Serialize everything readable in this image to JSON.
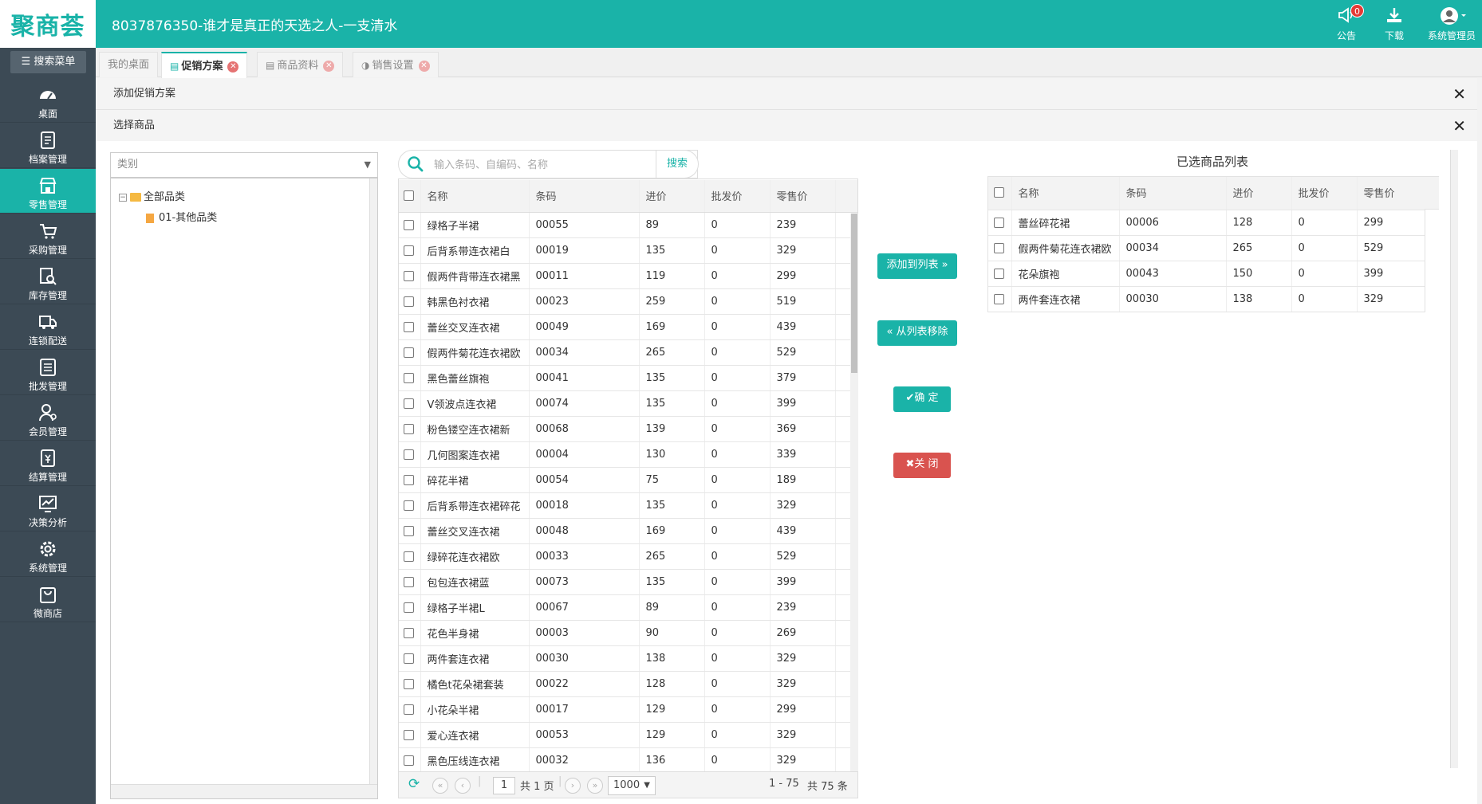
{
  "header": {
    "logo": "聚商荟",
    "title": "8037876350-谁才是真正的天选之人-一支清水",
    "notice": {
      "label": "公告",
      "badge": "0"
    },
    "download": {
      "label": "下载"
    },
    "user": {
      "label": "系统管理员"
    }
  },
  "sidebar": {
    "search_label": "搜索菜单",
    "items": [
      {
        "label": "桌面",
        "icon": "dashboard-icon"
      },
      {
        "label": "档案管理",
        "icon": "archive-icon"
      },
      {
        "label": "零售管理",
        "icon": "store-icon",
        "active": true
      },
      {
        "label": "采购管理",
        "icon": "cart-icon"
      },
      {
        "label": "库存管理",
        "icon": "inventory-icon"
      },
      {
        "label": "连锁配送",
        "icon": "delivery-icon"
      },
      {
        "label": "批发管理",
        "icon": "wholesale-icon"
      },
      {
        "label": "会员管理",
        "icon": "member-icon"
      },
      {
        "label": "结算管理",
        "icon": "settlement-icon"
      },
      {
        "label": "决策分析",
        "icon": "analysis-icon"
      },
      {
        "label": "系统管理",
        "icon": "gear-icon"
      },
      {
        "label": "微商店",
        "icon": "shop-bag-icon"
      }
    ]
  },
  "tabs": [
    {
      "label": "我的桌面"
    },
    {
      "label": "促销方案",
      "active": true
    },
    {
      "label": "商品资料"
    },
    {
      "label": "销售设置"
    }
  ],
  "panels": {
    "add_promo": "添加促销方案",
    "select_goods": "选择商品"
  },
  "category": {
    "placeholder": "类别",
    "root": "全部品类",
    "child": "01-其他品类"
  },
  "search": {
    "placeholder": "输入条码、自编码、名称",
    "button": "搜索"
  },
  "product_table": {
    "headers": [
      "名称",
      "条码",
      "进价",
      "批发价",
      "零售价"
    ],
    "rows": [
      [
        "绿格子半裙",
        "00055",
        "89",
        "0",
        "239"
      ],
      [
        "后背系带连衣裙白",
        "00019",
        "135",
        "0",
        "329"
      ],
      [
        "假两件背带连衣裙黑",
        "00011",
        "119",
        "0",
        "299"
      ],
      [
        "韩黑色衬衣裙",
        "00023",
        "259",
        "0",
        "519"
      ],
      [
        "蕾丝交叉连衣裙",
        "00049",
        "169",
        "0",
        "439"
      ],
      [
        "假两件菊花连衣裙欧",
        "00034",
        "265",
        "0",
        "529"
      ],
      [
        "黑色蕾丝旗袍",
        "00041",
        "135",
        "0",
        "379"
      ],
      [
        "V领波点连衣裙",
        "00074",
        "135",
        "0",
        "399"
      ],
      [
        "粉色镂空连衣裙新",
        "00068",
        "139",
        "0",
        "369"
      ],
      [
        "几何图案连衣裙",
        "00004",
        "130",
        "0",
        "339"
      ],
      [
        "碎花半裙",
        "00054",
        "75",
        "0",
        "189"
      ],
      [
        "后背系带连衣裙碎花",
        "00018",
        "135",
        "0",
        "329"
      ],
      [
        "蕾丝交叉连衣裙",
        "00048",
        "169",
        "0",
        "439"
      ],
      [
        "绿碎花连衣裙欧",
        "00033",
        "265",
        "0",
        "529"
      ],
      [
        "包包连衣裙蓝",
        "00073",
        "135",
        "0",
        "399"
      ],
      [
        "绿格子半裙L",
        "00067",
        "89",
        "0",
        "239"
      ],
      [
        "花色半身裙",
        "00003",
        "90",
        "0",
        "269"
      ],
      [
        "两件套连衣裙",
        "00030",
        "138",
        "0",
        "329"
      ],
      [
        "橘色t花朵裙套装",
        "00022",
        "128",
        "0",
        "329"
      ],
      [
        "小花朵半裙",
        "00017",
        "129",
        "0",
        "299"
      ],
      [
        "爱心连衣裙",
        "00053",
        "129",
        "0",
        "329"
      ],
      [
        "黑色压线连衣裙",
        "00032",
        "136",
        "0",
        "329"
      ]
    ]
  },
  "pager": {
    "page": "1",
    "total_pages": "共 1 页",
    "page_size": "1000",
    "range": "1 - 75",
    "total": "共 75 条"
  },
  "actions": {
    "add_to_list": "添加到列表",
    "remove_from_list": "从列表移除",
    "confirm": "确 定",
    "close": "关 闭"
  },
  "selected": {
    "title": "已选商品列表",
    "headers": [
      "名称",
      "条码",
      "进价",
      "批发价",
      "零售价"
    ],
    "rows": [
      [
        "蕾丝碎花裙",
        "00006",
        "128",
        "0",
        "299"
      ],
      [
        "假两件菊花连衣裙欧",
        "00034",
        "265",
        "0",
        "529"
      ],
      [
        "花朵旗袍",
        "00043",
        "150",
        "0",
        "399"
      ],
      [
        "两件套连衣裙",
        "00030",
        "138",
        "0",
        "329"
      ]
    ]
  },
  "colors": {
    "accent": "#1ab3a8",
    "sidebar": "#3c4a55",
    "danger": "#d9534f"
  }
}
